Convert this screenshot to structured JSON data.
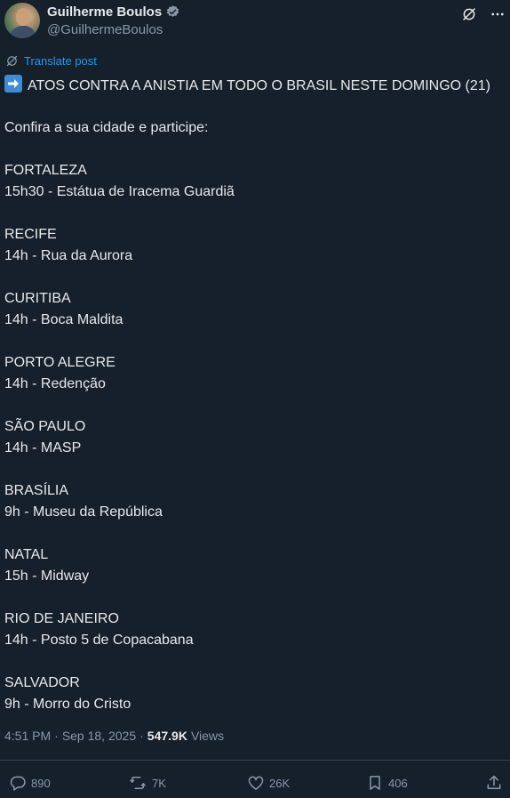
{
  "author": {
    "display_name": "Guilherme Boulos",
    "handle": "@GuilhermeBoulos"
  },
  "translate_label": "Translate post",
  "post": {
    "lines": [
      "ATOS CONTRA A ANISTIA EM TODO O BRASIL NESTE DOMINGO (21)",
      "",
      "Confira a sua cidade e participe:",
      "",
      "FORTALEZA",
      "15h30 - Estátua de Iracema Guardiã",
      "",
      "RECIFE",
      "14h - Rua da Aurora",
      "",
      "CURITIBA",
      "14h - Boca Maldita",
      "",
      "PORTO ALEGRE",
      "14h - Redenção",
      "",
      "SÃO PAULO",
      "14h - MASP",
      "",
      "BRASÍLIA",
      "9h - Museu da República",
      "",
      "NATAL",
      "15h - Midway",
      "",
      "RIO DE JANEIRO",
      "14h - Posto 5 de Copacabana",
      "",
      "SALVADOR",
      "9h - Morro do Cristo"
    ]
  },
  "meta": {
    "time": "4:51 PM",
    "date": "Sep 18, 2025",
    "views_count": "547.9K",
    "views_label": "Views"
  },
  "actions": {
    "replies": "890",
    "reposts": "7K",
    "likes": "26K",
    "bookmarks": "406"
  },
  "colors": {
    "background": "#15202b",
    "text": "#e7e9ea",
    "muted": "#8b98a5",
    "link": "#1d9bf0",
    "verified": "#8b98a5"
  },
  "icons": [
    "verified-badge-icon",
    "grok-icon",
    "more-icon",
    "translate-icon",
    "arrow-right-emoji",
    "reply-icon",
    "repost-icon",
    "like-icon",
    "bookmark-icon",
    "share-icon"
  ]
}
